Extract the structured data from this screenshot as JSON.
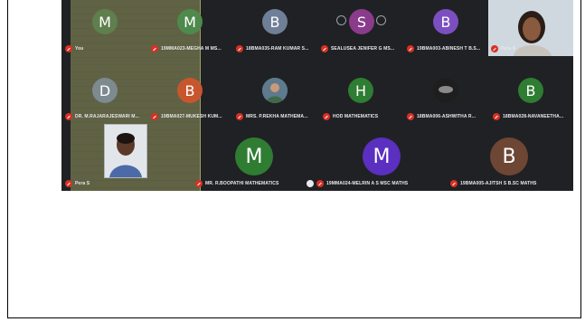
{
  "tiles": [
    {
      "avatar": "M",
      "color": "#5f7f4d",
      "name": "You"
    },
    {
      "avatar": "M",
      "color": "#4e8a4c",
      "name": "19MMA023-MEGHA M MS..."
    },
    {
      "avatar": "B",
      "color": "#6e7f97",
      "name": "18BMA035-RAM KUMAR S..."
    },
    {
      "avatar": "S",
      "color": "#8a3b8c",
      "name": "SEALUSEA JENIFER G MS..."
    },
    {
      "avatar": "B",
      "color": "#7b4fbf",
      "name": "19BMA003-ABINESH T B.S..."
    },
    {
      "avatar": "",
      "color": "",
      "name": "Pera S"
    },
    {
      "avatar": "D",
      "color": "#7d8a8f",
      "name": "DR. M.RAJARAJESWARI M..."
    },
    {
      "avatar": "B",
      "color": "#c8562c",
      "name": "19BMA027-MUKESH KUM..."
    },
    {
      "avatar": "",
      "color": "",
      "name": "MRS. P.REKHA MATHEMA..."
    },
    {
      "avatar": "H",
      "color": "#2e7d32",
      "name": "HOD MATHEMATICS"
    },
    {
      "avatar": "",
      "color": "",
      "name": "18BMA006-ASHWITHA R..."
    },
    {
      "avatar": "B",
      "color": "#2e7d32",
      "name": "18BMA028-NAVANEETHA..."
    },
    {
      "avatar": "",
      "color": "",
      "name": "Pera S"
    },
    {
      "avatar": "M",
      "color": "#2f7d32",
      "name": "MR. R.BOOPATHI MATHEMATICS"
    },
    {
      "avatar": "M",
      "color": "#5b2fbf",
      "name": "19MMA024-MELRIN A S MSC MATHS"
    },
    {
      "avatar": "B",
      "color": "#6d4634",
      "name": "19BMA005-AJITSH S B.SC MATHS"
    }
  ]
}
